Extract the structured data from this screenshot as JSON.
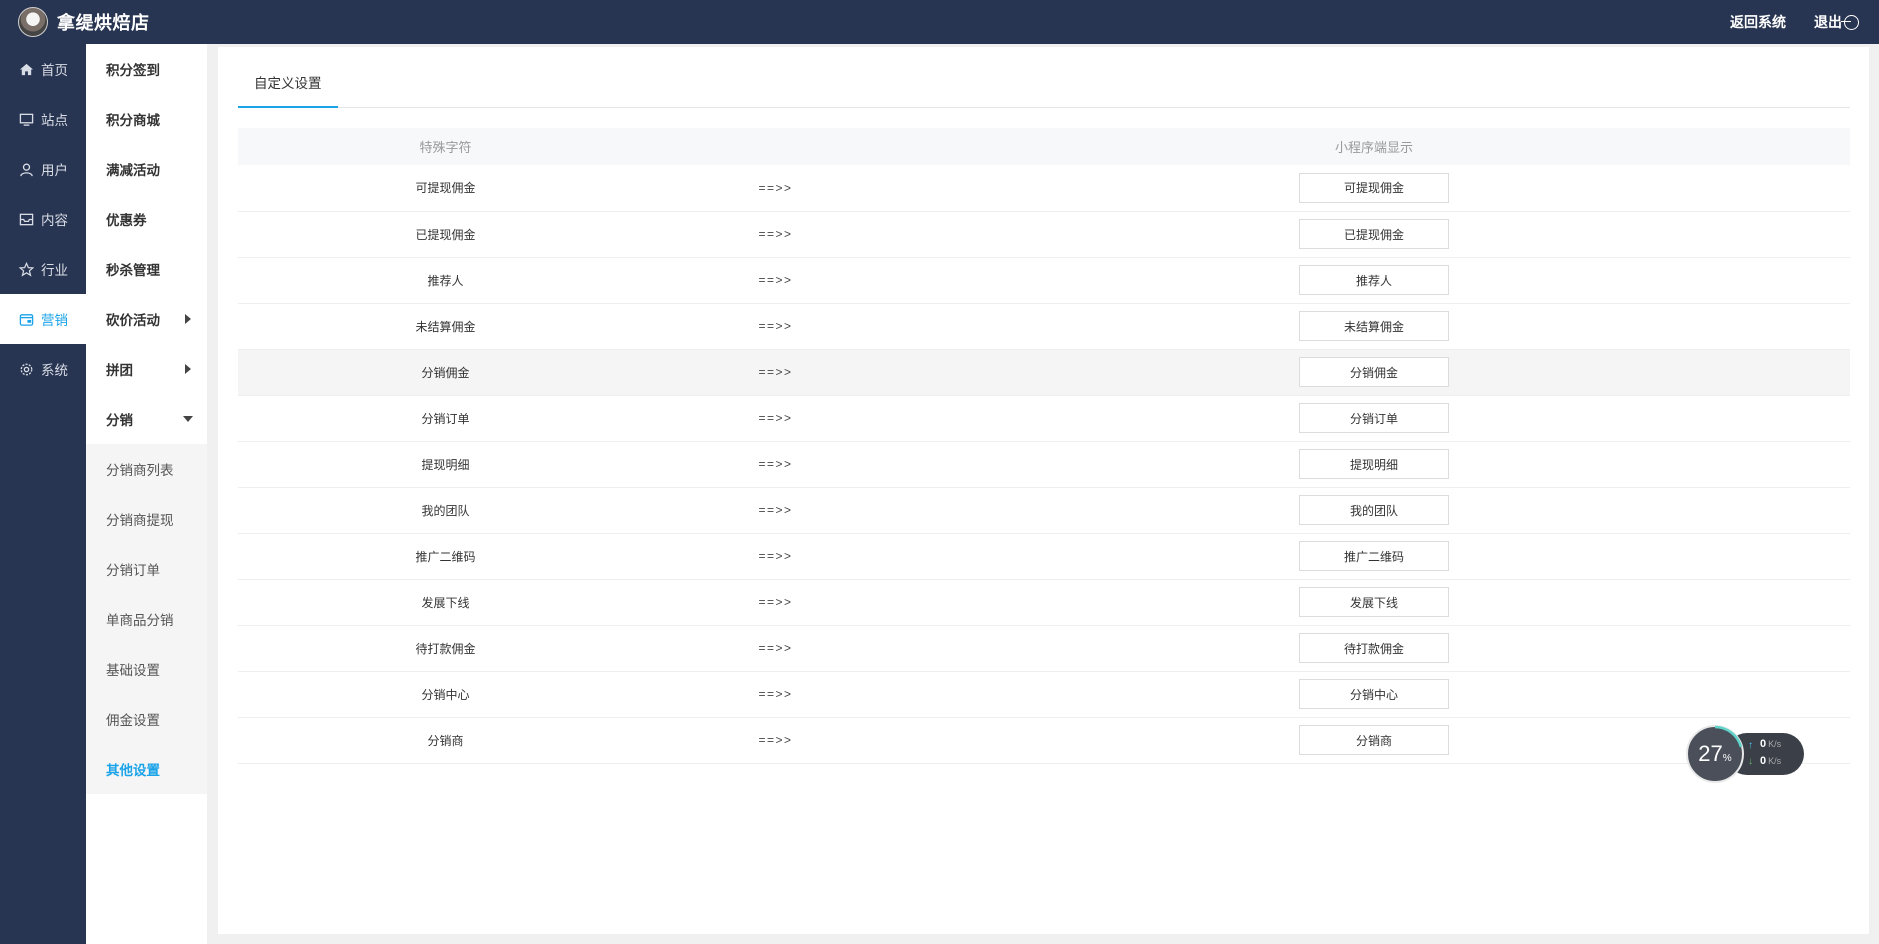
{
  "topbar": {
    "store_name": "拿缇烘焙店",
    "return_label": "返回系统",
    "logout_label": "退出"
  },
  "nav1": [
    {
      "label": "首页",
      "icon": "home-icon"
    },
    {
      "label": "站点",
      "icon": "monitor-icon"
    },
    {
      "label": "用户",
      "icon": "user-icon"
    },
    {
      "label": "内容",
      "icon": "inbox-icon"
    },
    {
      "label": "行业",
      "icon": "star-icon"
    },
    {
      "label": "营销",
      "icon": "wallet-icon",
      "active": true
    },
    {
      "label": "系统",
      "icon": "gear-icon"
    }
  ],
  "nav2": {
    "items": [
      "积分签到",
      "积分商城",
      "满减活动",
      "优惠券",
      "秒杀管理",
      "砍价活动",
      "拼团",
      "分销"
    ],
    "sub_items": [
      "分销商列表",
      "分销商提现",
      "分销订单",
      "单商品分销",
      "基础设置",
      "佣金设置",
      "其他设置"
    ],
    "active_sub": "其他设置"
  },
  "tab": {
    "label": "自定义设置"
  },
  "table": {
    "headers": [
      "特殊字符",
      "",
      "小程序端显示"
    ],
    "arrow": "==>>",
    "rows": [
      {
        "key": "可提现佣金",
        "value": "可提现佣金"
      },
      {
        "key": "已提现佣金",
        "value": "已提现佣金"
      },
      {
        "key": "推荐人",
        "value": "推荐人"
      },
      {
        "key": "未结算佣金",
        "value": "未结算佣金"
      },
      {
        "key": "分销佣金",
        "value": "分销佣金"
      },
      {
        "key": "分销订单",
        "value": "分销订单"
      },
      {
        "key": "提现明细",
        "value": "提现明细"
      },
      {
        "key": "我的团队",
        "value": "我的团队"
      },
      {
        "key": "推广二维码",
        "value": "推广二维码"
      },
      {
        "key": "发展下线",
        "value": "发展下线"
      },
      {
        "key": "待打款佣金",
        "value": "待打款佣金"
      },
      {
        "key": "分销中心",
        "value": "分销中心"
      },
      {
        "key": "分销商",
        "value": "分销商"
      }
    ]
  },
  "net_widget": {
    "percent": "27",
    "percent_unit": "%",
    "up_value": "0",
    "down_value": "0",
    "unit": "K/s"
  },
  "colors": {
    "topbar": "#283552",
    "accent": "#1aa3e8"
  }
}
